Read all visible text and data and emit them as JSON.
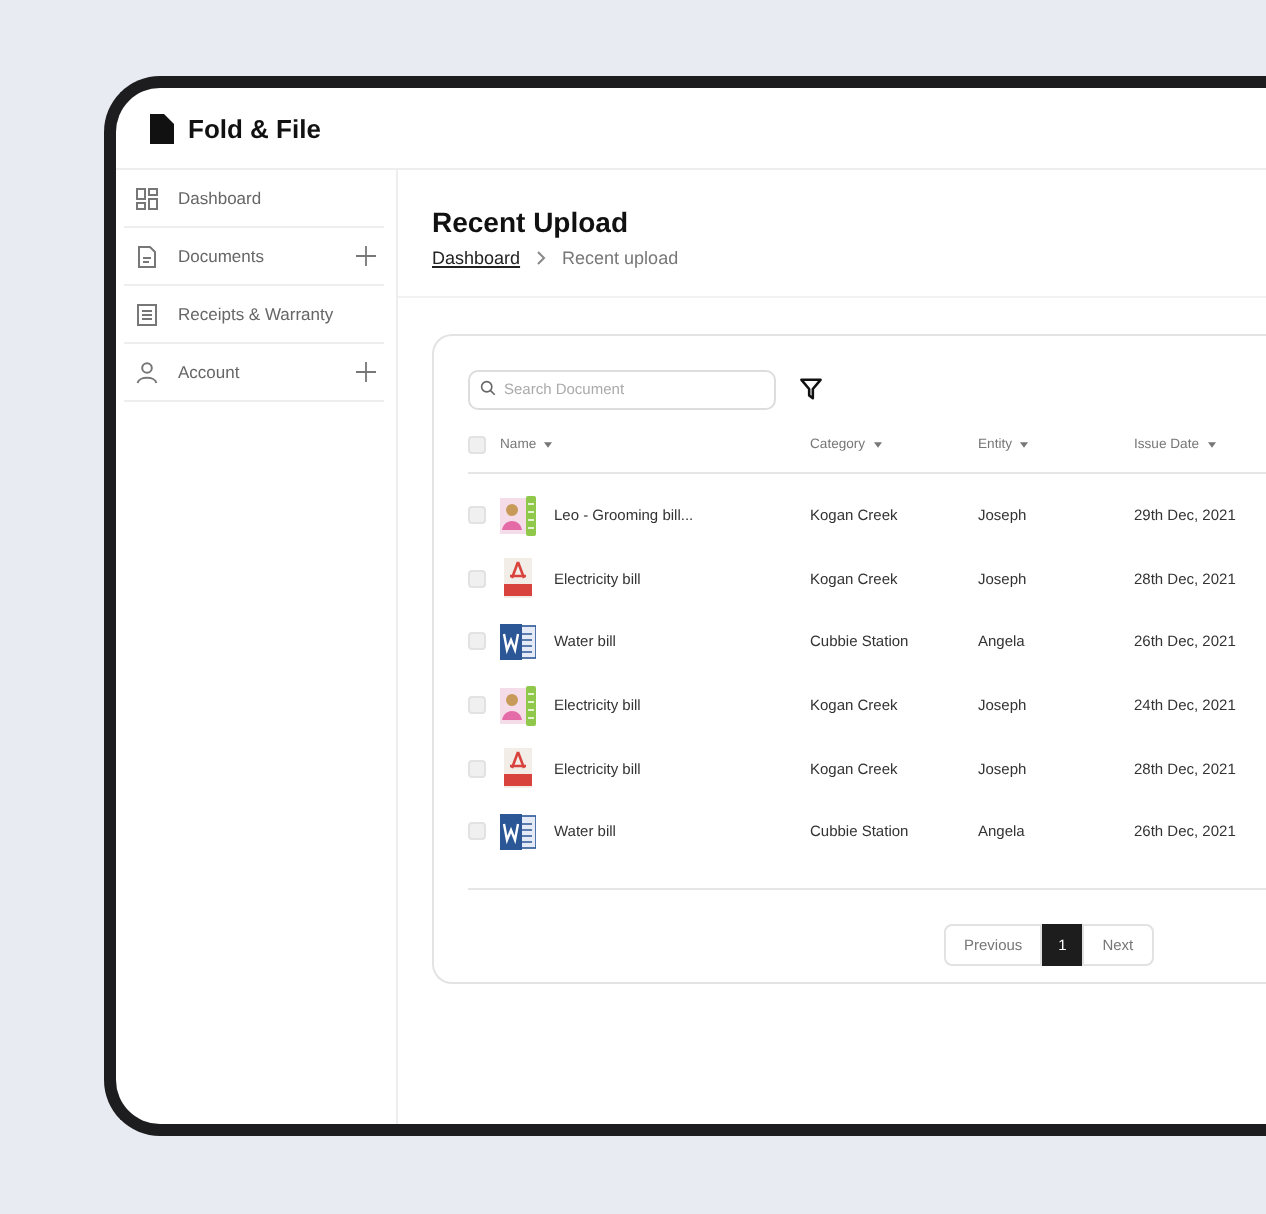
{
  "brand": {
    "name": "Fold & File"
  },
  "sidebar": {
    "items": [
      {
        "label": "Dashboard",
        "kind": "grid",
        "expandable": false
      },
      {
        "label": "Documents",
        "kind": "document",
        "expandable": true
      },
      {
        "label": "Receipts & Warranty",
        "kind": "receipt",
        "expandable": false
      },
      {
        "label": "Account",
        "kind": "user",
        "expandable": true
      }
    ]
  },
  "page": {
    "title": "Recent Upload",
    "breadcrumb": [
      "Dashboard",
      "Recent upload"
    ]
  },
  "search": {
    "placeholder": "Search Document"
  },
  "table": {
    "columns": [
      "Name",
      "Category",
      "Entity",
      "Issue Date"
    ],
    "all_checked": false,
    "rows": [
      {
        "kind": "image",
        "name": "Leo - Grooming bill...",
        "category": "Kogan Creek",
        "entity": "Joseph",
        "date": "29th Dec, 2021",
        "checked": false
      },
      {
        "kind": "pdf",
        "name": "Electricity bill",
        "category": "Kogan Creek",
        "entity": "Joseph",
        "date": "28th Dec, 2021",
        "checked": false
      },
      {
        "kind": "word",
        "name": "Water bill",
        "category": "Cubbie Station",
        "entity": "Angela",
        "date": "26th Dec, 2021",
        "checked": false
      },
      {
        "kind": "image",
        "name": "Electricity bill",
        "category": "Kogan Creek",
        "entity": "Joseph",
        "date": "24th Dec, 2021",
        "checked": false
      },
      {
        "kind": "pdf",
        "name": "Electricity bill",
        "category": "Kogan Creek",
        "entity": "Joseph",
        "date": "28th Dec, 2021",
        "checked": false
      },
      {
        "kind": "word",
        "name": "Water bill",
        "category": "Cubbie Station",
        "entity": "Angela",
        "date": "26th Dec, 2021",
        "checked": false
      }
    ]
  },
  "pagination": {
    "previous": "Previous",
    "next": "Next",
    "pages": [
      {
        "label": "1",
        "selected": true
      }
    ]
  }
}
